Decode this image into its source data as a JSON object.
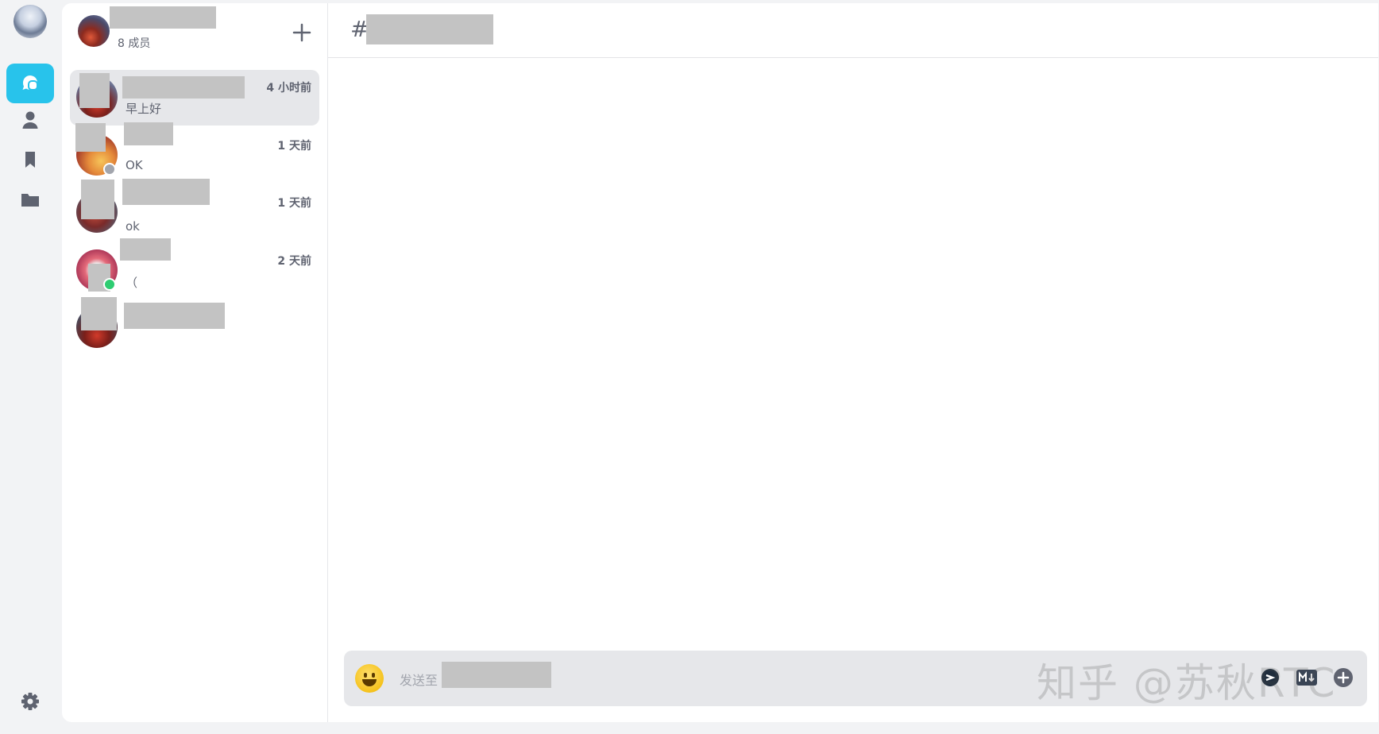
{
  "group": {
    "member_count": "8 成员"
  },
  "conversations": [
    {
      "time": "4 小时前",
      "preview": "早上好",
      "active": true
    },
    {
      "time": "1 天前",
      "preview": "OK",
      "status": "offline"
    },
    {
      "time": "1 天前",
      "preview": "ok"
    },
    {
      "time": "2 天前",
      "preview": "（",
      "status": "online"
    },
    {
      "time": "",
      "preview": ""
    }
  ],
  "channel": {
    "hash": "#"
  },
  "composer": {
    "placeholder_prefix": "发送至"
  },
  "watermark": "知乎 @苏秋RTC",
  "colors": {
    "accent": "#28c3eb",
    "online": "#2ecc71",
    "offline": "#a2a5ad",
    "redaction": "#c3c3c3"
  },
  "icons": {
    "rail": [
      "chat-icon",
      "user-icon",
      "bookmark-icon",
      "folder-icon",
      "gear-icon"
    ],
    "composer": [
      "emoji-icon",
      "screenshot-icon",
      "markdown-icon",
      "plus-circle-icon"
    ]
  }
}
